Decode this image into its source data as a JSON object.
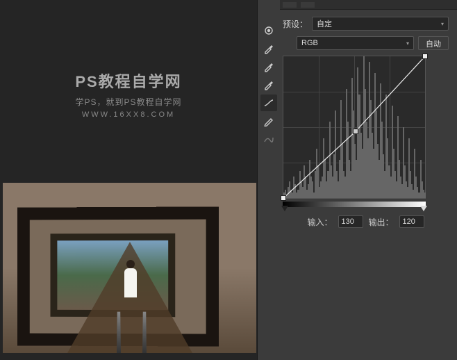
{
  "watermark": {
    "title": "PS教程自学网",
    "subtitle": "学PS，就到PS教程自学网",
    "url": "WWW.16XX8.COM"
  },
  "panel": {
    "preset_label": "预设：",
    "preset_value": "自定",
    "channel_value": "RGB",
    "auto_label": "自动",
    "input_label": "输入：",
    "input_value": "130",
    "output_label": "输出：",
    "output_value": "120"
  },
  "chart_data": {
    "type": "line",
    "title": "",
    "xlabel": "输入",
    "ylabel": "输出",
    "xlim": [
      0,
      255
    ],
    "ylim": [
      0,
      255
    ],
    "points": [
      {
        "x": 0,
        "y": 0
      },
      {
        "x": 130,
        "y": 120
      },
      {
        "x": 255,
        "y": 255
      }
    ],
    "histogram_approx": [
      2,
      3,
      1,
      4,
      6,
      3,
      2,
      8,
      5,
      2,
      3,
      10,
      6,
      4,
      12,
      8,
      3,
      5,
      14,
      8,
      6,
      2,
      10,
      18,
      12,
      4,
      6,
      8,
      22,
      14,
      6,
      10,
      28,
      12,
      8,
      16,
      32,
      10,
      6,
      14,
      36,
      20,
      10,
      8,
      40,
      28,
      14,
      10,
      44,
      32,
      20,
      14,
      48,
      38,
      24,
      18,
      52,
      40,
      28,
      22,
      50,
      36,
      24,
      18,
      46,
      32,
      20,
      14,
      42,
      28,
      16,
      10,
      38,
      22,
      12,
      8,
      34,
      18,
      10,
      6,
      30,
      14,
      8,
      5,
      26,
      12,
      6,
      4,
      22,
      10,
      5,
      3,
      18,
      8,
      4,
      2,
      14,
      6,
      3,
      2
    ]
  }
}
